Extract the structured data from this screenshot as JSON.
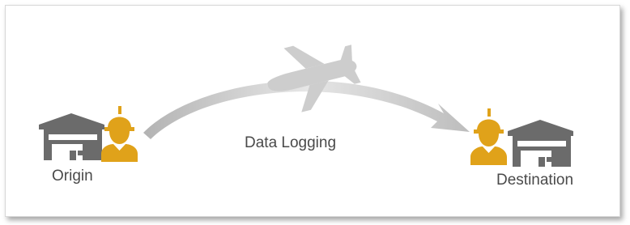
{
  "labels": {
    "origin": "Origin",
    "process": "Data Logging",
    "destination": "Destination"
  },
  "icons": {
    "origin_warehouse": "warehouse-icon",
    "origin_worker": "worker-icon",
    "airplane": "airplane-icon",
    "flight_path": "curved-arrow",
    "destination_worker": "worker-icon",
    "destination_warehouse": "warehouse-icon"
  },
  "colors": {
    "warehouse": "#6b6b6b",
    "worker": "#e0a21a",
    "arrow": "#c8c8c8",
    "airplane": "#cfcfcf",
    "text": "#4a4a4a"
  }
}
